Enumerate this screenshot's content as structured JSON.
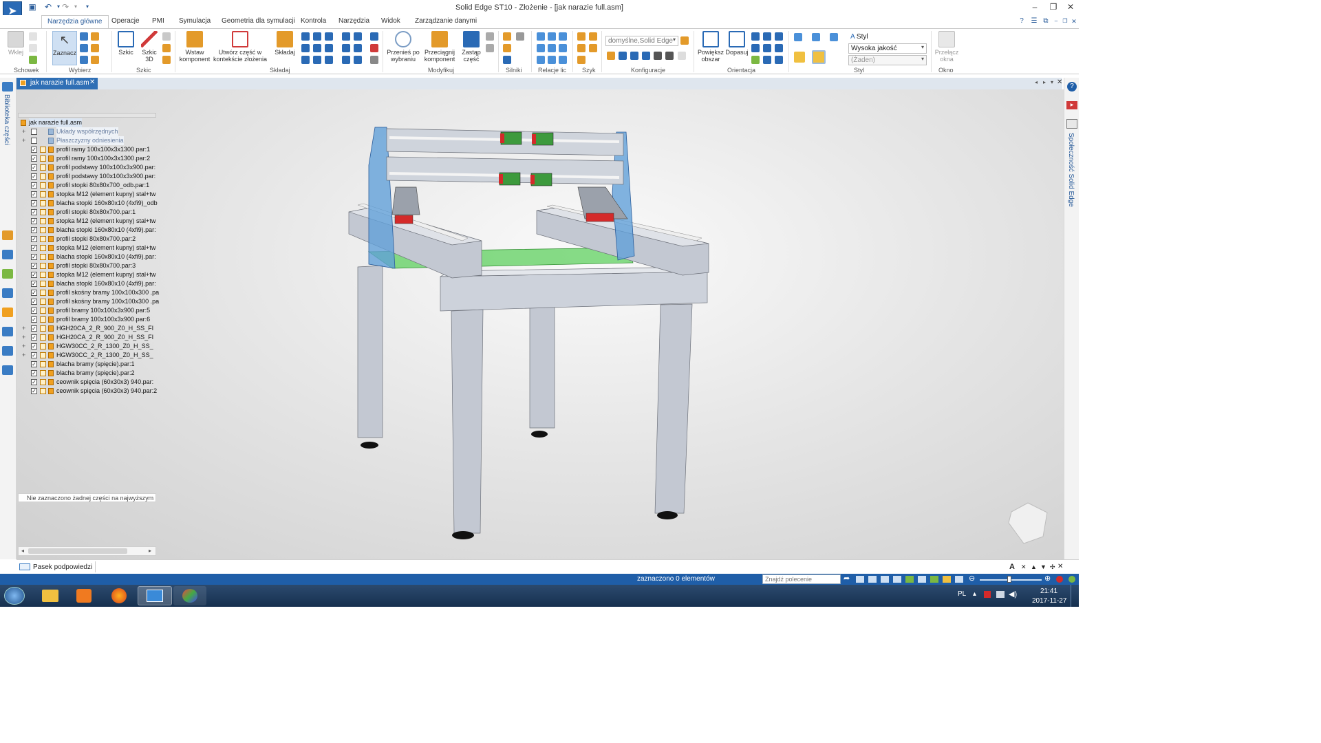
{
  "window": {
    "title": "Solid Edge ST10 - Złożenie - [jak narazie full.asm]"
  },
  "ribbon_tabs": [
    "Narzędzia główne",
    "Operacje",
    "PMI",
    "Symulacja",
    "Geometria dla symulacji",
    "Kontrola",
    "Narzędzia",
    "Widok",
    "Zarządzanie danymi"
  ],
  "ribbon": {
    "paste": "Wklej",
    "clipboard_group": "Schowek",
    "select": "Zaznacz",
    "select_group": "Wybierz",
    "sketch": "Szkic",
    "sketch3d_line1": "Szkic",
    "sketch3d_line2": "3D",
    "sketch_group": "Szkic",
    "insert_line1": "Wstaw",
    "insert_line2": "komponent",
    "create_line1": "Utwórz część w",
    "create_line2": "kontekście złożenia",
    "assemble": "Składaj",
    "assemble_group": "Składaj",
    "move_line1": "Przenieś po",
    "move_line2": "wybraniu",
    "drag_line1": "Przeciągnij",
    "drag_line2": "komponent",
    "replace_line1": "Zastąp",
    "replace_line2": "część",
    "modify_group": "Modyfikuj",
    "motors_group": "Silniki",
    "relations_group": "Relacje lic",
    "pattern_group": "Szyk",
    "config_value": "domyślne,Solid Edge",
    "config_group": "Konfiguracje",
    "zoom_area_line1": "Powiększ",
    "zoom_area_line2": "obszar",
    "fit": "Dopasuj",
    "orient_group": "Orientacja",
    "style_label": "Styl",
    "quality_value": "Wysoka jakość",
    "style_none": "(Żaden)",
    "style_group": "Styl",
    "switch_line1": "Przełącz",
    "switch_line2": "okna",
    "window_group": "Okno"
  },
  "doc_tab": "jak narazie full.asm",
  "side_left": "Biblioteka części",
  "side_right": "Społeczność Solid Edge",
  "pathfinder": {
    "root": "jak narazie full.asm",
    "items": [
      {
        "label": "Układy współrzędnych",
        "checked": false,
        "expand": "+",
        "dim": true
      },
      {
        "label": "Płaszczyzny odniesienia",
        "checked": false,
        "expand": "+",
        "dim": true
      },
      {
        "label": "profil ramy 100x100x3x1300.par:1",
        "checked": true,
        "expand": "",
        "dim": false
      },
      {
        "label": "profil ramy 100x100x3x1300.par:2",
        "checked": true,
        "expand": "",
        "dim": false
      },
      {
        "label": "profil podstawy 100x100x3x900.par:",
        "checked": true,
        "expand": "",
        "dim": false
      },
      {
        "label": "profil podstawy 100x100x3x900.par:",
        "checked": true,
        "expand": "",
        "dim": false
      },
      {
        "label": "profil stopki 80x80x700_odb.par:1",
        "checked": true,
        "expand": "",
        "dim": false
      },
      {
        "label": "stopka M12 (element kupny) stal+tw",
        "checked": true,
        "expand": "",
        "dim": false
      },
      {
        "label": "blacha stopki 160x80x10 (4xfi9)_odb",
        "checked": true,
        "expand": "",
        "dim": false
      },
      {
        "label": "profil stopki 80x80x700.par:1",
        "checked": true,
        "expand": "",
        "dim": false
      },
      {
        "label": "stopka M12 (element kupny) stal+tw",
        "checked": true,
        "expand": "",
        "dim": false
      },
      {
        "label": "blacha stopki 160x80x10 (4xfi9).par:",
        "checked": true,
        "expand": "",
        "dim": false
      },
      {
        "label": "profil stopki 80x80x700.par:2",
        "checked": true,
        "expand": "",
        "dim": false
      },
      {
        "label": "stopka M12 (element kupny) stal+tw",
        "checked": true,
        "expand": "",
        "dim": false
      },
      {
        "label": "blacha stopki 160x80x10 (4xfi9).par:",
        "checked": true,
        "expand": "",
        "dim": false
      },
      {
        "label": "profil stopki 80x80x700.par:3",
        "checked": true,
        "expand": "",
        "dim": false
      },
      {
        "label": "stopka M12 (element kupny) stal+tw",
        "checked": true,
        "expand": "",
        "dim": false
      },
      {
        "label": "blacha stopki 160x80x10 (4xfi9).par:",
        "checked": true,
        "expand": "",
        "dim": false
      },
      {
        "label": "profil skośny bramy 100x100x300 .pa",
        "checked": true,
        "expand": "",
        "dim": false
      },
      {
        "label": "profil skośny bramy 100x100x300 .pa",
        "checked": true,
        "expand": "",
        "dim": false
      },
      {
        "label": "profil bramy 100x100x3x900.par:5",
        "checked": true,
        "expand": "",
        "dim": false
      },
      {
        "label": "profil bramy 100x100x3x900.par:6",
        "checked": true,
        "expand": "",
        "dim": false
      },
      {
        "label": "HGH20CA_2_R_900_Z0_H_SS_FI",
        "checked": true,
        "expand": "+",
        "dim": false
      },
      {
        "label": "HGH20CA_2_R_900_Z0_H_SS_FI",
        "checked": true,
        "expand": "+",
        "dim": false
      },
      {
        "label": "HGW30CC_2_R_1300_Z0_H_SS_",
        "checked": true,
        "expand": "+",
        "dim": false
      },
      {
        "label": "HGW30CC_2_R_1300_Z0_H_SS_",
        "checked": true,
        "expand": "+",
        "dim": false
      },
      {
        "label": "blacha bramy (spięcie).par:1",
        "checked": true,
        "expand": "",
        "dim": false
      },
      {
        "label": "blacha bramy (spięcie).par:2",
        "checked": true,
        "expand": "",
        "dim": false
      },
      {
        "label": "ceownik spięcia (60x30x3) 940.par:",
        "checked": true,
        "expand": "",
        "dim": false
      },
      {
        "label": "ceownik spięcia (60x30x3) 940.par:2",
        "checked": true,
        "expand": "",
        "dim": false
      }
    ],
    "status": "Nie zaznaczono żadnej części na najwyższym po"
  },
  "prompt_bar": "Pasek podpowiedzi",
  "status": {
    "selected": "zaznaczono 0 elementów",
    "search_placeholder": "Znajdź polecenie"
  },
  "taskbar": {
    "lang": "PL",
    "time": "21:41",
    "date": "2017-11-27"
  },
  "colors": {
    "accent": "#2a6ab5",
    "statusbar": "#1f5ea8",
    "frame": "#b8bdc6",
    "gantry": "#5f9fd8",
    "rail": "#e8e8e8",
    "carriage": "#d42a2a",
    "plate": "#5fd05f"
  }
}
